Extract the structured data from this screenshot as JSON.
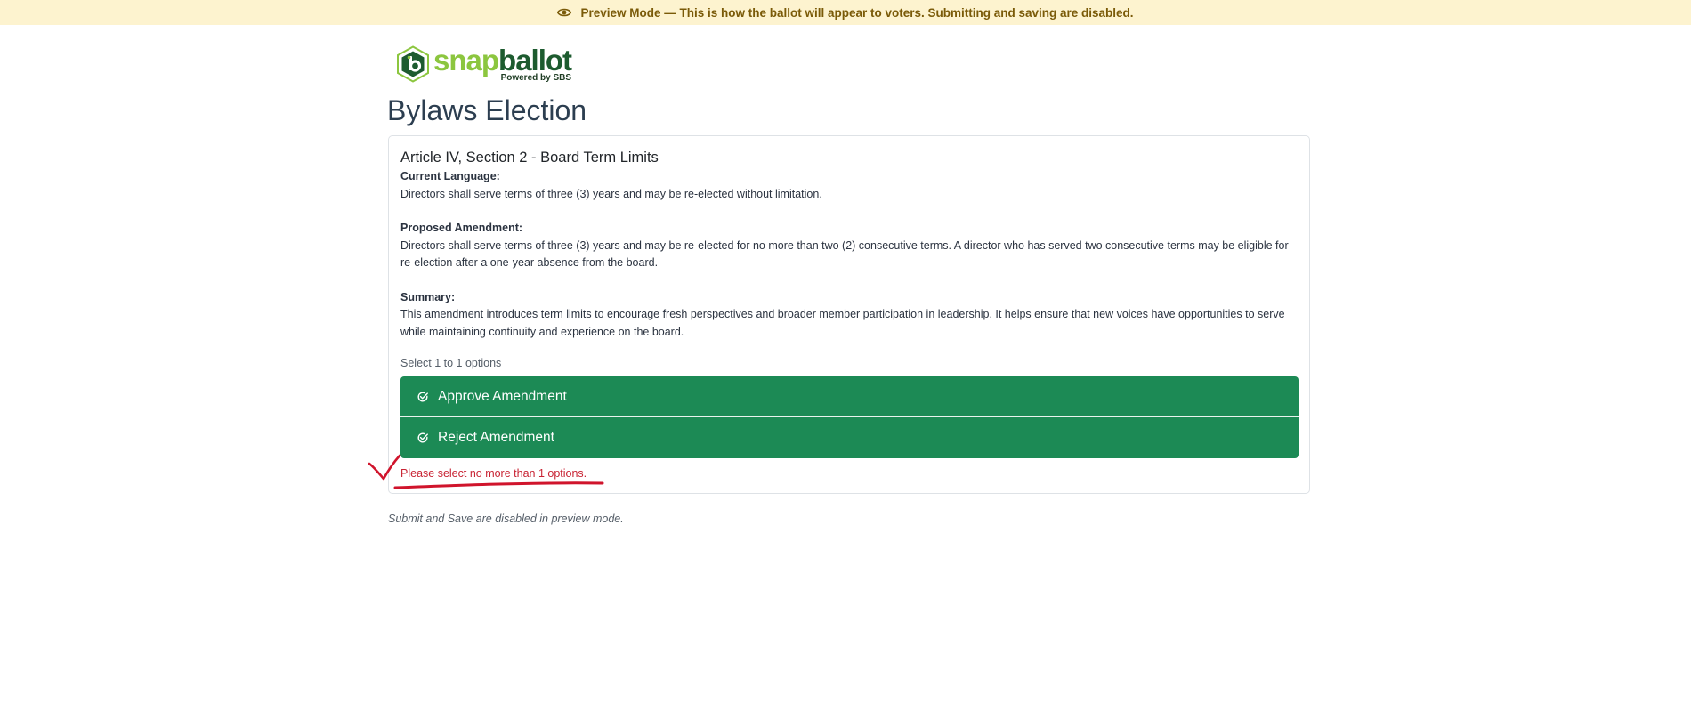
{
  "banner": {
    "text": "Preview Mode — This is how the ballot will appear to voters. Submitting and saving are disabled.",
    "icon": "eye-icon"
  },
  "logo": {
    "word_snap": "snap",
    "word_ballot": "ballot",
    "powered": "Powered by SBS"
  },
  "election": {
    "title": "Bylaws Election"
  },
  "question": {
    "title": "Article IV, Section 2 - Board Term Limits",
    "current_label": "Current Language:",
    "current_text": "Directors shall serve terms of three (3) years and may be re-elected without limitation.",
    "proposed_label": "Proposed Amendment:",
    "proposed_text": "Directors shall serve terms of three (3) years and may be re-elected for no more than two (2) consecutive terms. A director who has served two consecutive terms may be eligible for re-election after a one-year absence from the board.",
    "summary_label": "Summary:",
    "summary_text": "This amendment introduces term limits to encourage fresh perspectives and broader member participation in leadership. It helps ensure that new voices have opportunities to serve while maintaining continuity and experience on the board.",
    "select_hint": "Select 1 to 1 options",
    "options": [
      {
        "label": "Approve Amendment",
        "selected": true
      },
      {
        "label": "Reject Amendment",
        "selected": true
      }
    ],
    "error": "Please select no more than 1 options."
  },
  "footer": {
    "note": "Submit and Save are disabled in preview mode."
  },
  "colors": {
    "banner_bg": "#fdf3cf",
    "option_green": "#1c8a55",
    "error_red": "#c82333",
    "annotation_red": "#d0142c"
  }
}
